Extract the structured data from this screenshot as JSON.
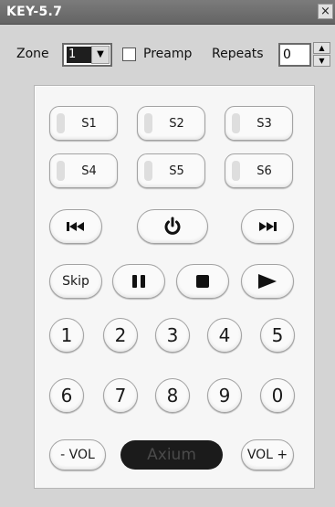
{
  "window": {
    "title": "KEY-5.7",
    "close_label": "×"
  },
  "toolbar": {
    "zone_label": "Zone",
    "zone_value": "1",
    "preamp_label": "Preamp",
    "preamp_checked": false,
    "repeats_label": "Repeats",
    "repeats_value": "0"
  },
  "scenes": [
    "S1",
    "S2",
    "S3",
    "S4",
    "S5",
    "S6"
  ],
  "transport": {
    "skip_label": "Skip",
    "icons": [
      "previous-icon",
      "power-icon",
      "next-icon",
      "pause-icon",
      "stop-icon",
      "play-icon"
    ]
  },
  "keypad": {
    "row1": [
      "1",
      "2",
      "3",
      "4",
      "5"
    ],
    "row2": [
      "6",
      "7",
      "8",
      "9",
      "0"
    ]
  },
  "volume": {
    "down_label": "- VOL",
    "up_label": "VOL +"
  },
  "brand": {
    "label": "Axium"
  },
  "colors": {
    "titlebar": "#6e6e6e",
    "panel": "#f6f6f6",
    "brand_bg": "#1b1b1b"
  }
}
